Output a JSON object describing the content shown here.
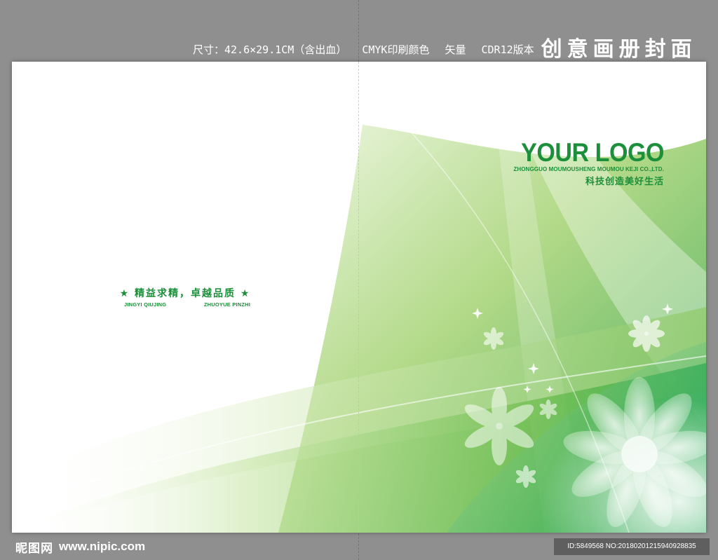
{
  "spec": {
    "size": "尺寸：42.6×29.1CM（含出血）",
    "color_mode": "CMYK印刷颜色",
    "format": "矢量",
    "version": "CDR12版本",
    "title": "创意画册封面"
  },
  "cover": {
    "logo": {
      "main": "YOUR LOGO",
      "company": "ZHONGGUO MOUMOUSHENG MOUMOU KEJI CO.,LTD.",
      "slogan": "科技创造美好生活"
    },
    "motto": {
      "text": "★ 精益求精，卓越品质 ★",
      "pinyin_left": "JINGYI QIUJING",
      "pinyin_right": "ZHUOYUE PINZHI"
    }
  },
  "footer": {
    "brand": "昵图网",
    "url": "www.nipic.com",
    "id": "ID:5849568 NO:20180201215940928835"
  },
  "colors": {
    "brand_green": "#1c8f3a",
    "frame_gray": "#8f8f8f",
    "paper": "#ffffff"
  }
}
